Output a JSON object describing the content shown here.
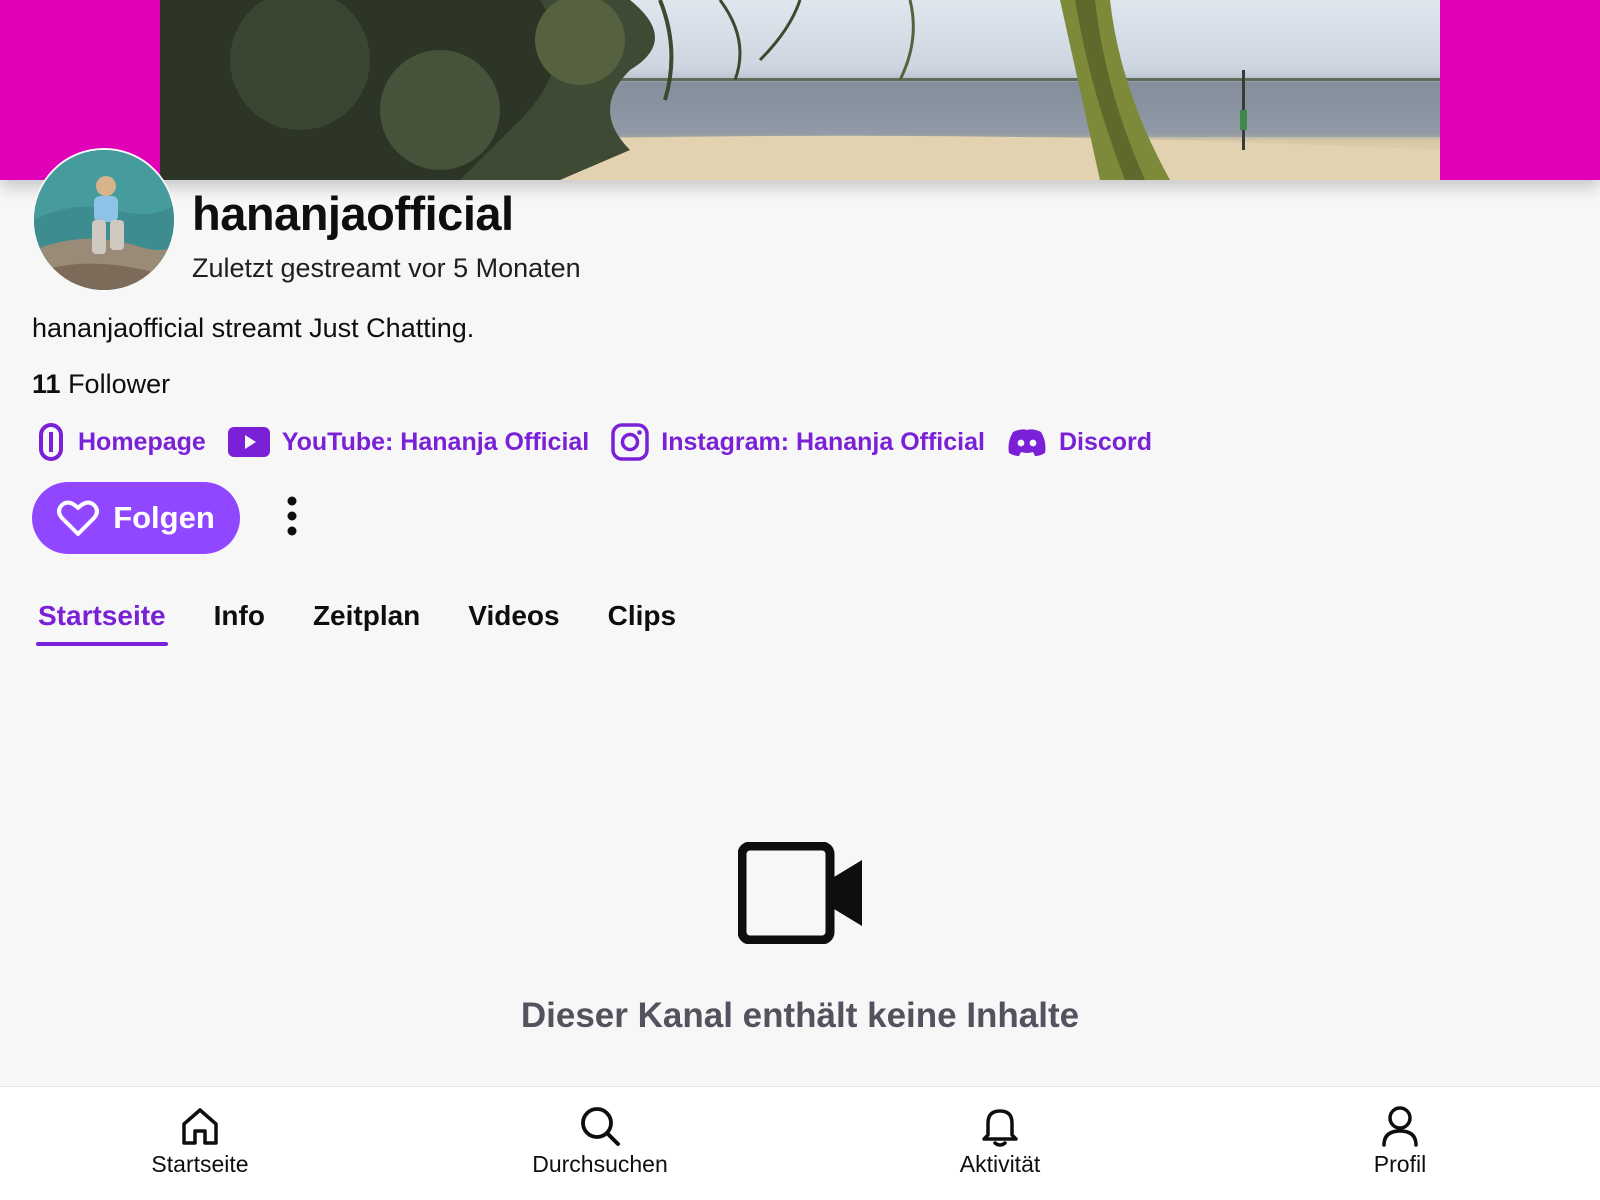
{
  "channel": {
    "name": "hananjaofficial",
    "last_stream": "Zuletzt gestreamt vor 5 Monaten",
    "description": "hananjaofficial streamt Just Chatting.",
    "follower_count": "11",
    "follower_label": "Follower"
  },
  "links": [
    {
      "label": "Homepage",
      "icon": "homepage-link-icon"
    },
    {
      "label": "YouTube: Hananja Official",
      "icon": "youtube-icon"
    },
    {
      "label": "Instagram: Hananja Official",
      "icon": "instagram-icon"
    },
    {
      "label": "Discord",
      "icon": "discord-icon"
    }
  ],
  "actions": {
    "follow_label": "Folgen",
    "follow_icon": "heart-icon",
    "more_icon": "more-vertical-icon"
  },
  "tabs": [
    {
      "label": "Startseite",
      "active": true
    },
    {
      "label": "Info",
      "active": false
    },
    {
      "label": "Zeitplan",
      "active": false
    },
    {
      "label": "Videos",
      "active": false
    },
    {
      "label": "Clips",
      "active": false
    }
  ],
  "empty_state": {
    "icon": "video-camera-icon",
    "message": "Dieser Kanal enthält keine Inhalte"
  },
  "bottom_nav": [
    {
      "label": "Startseite",
      "icon": "home-icon"
    },
    {
      "label": "Durchsuchen",
      "icon": "search-icon"
    },
    {
      "label": "Aktivität",
      "icon": "bell-icon"
    },
    {
      "label": "Profil",
      "icon": "profile-icon"
    }
  ],
  "colors": {
    "accent": "#9147ff",
    "link": "#7a20d6",
    "banner_background": "#e000b8",
    "page_background": "#f7f7f8"
  }
}
